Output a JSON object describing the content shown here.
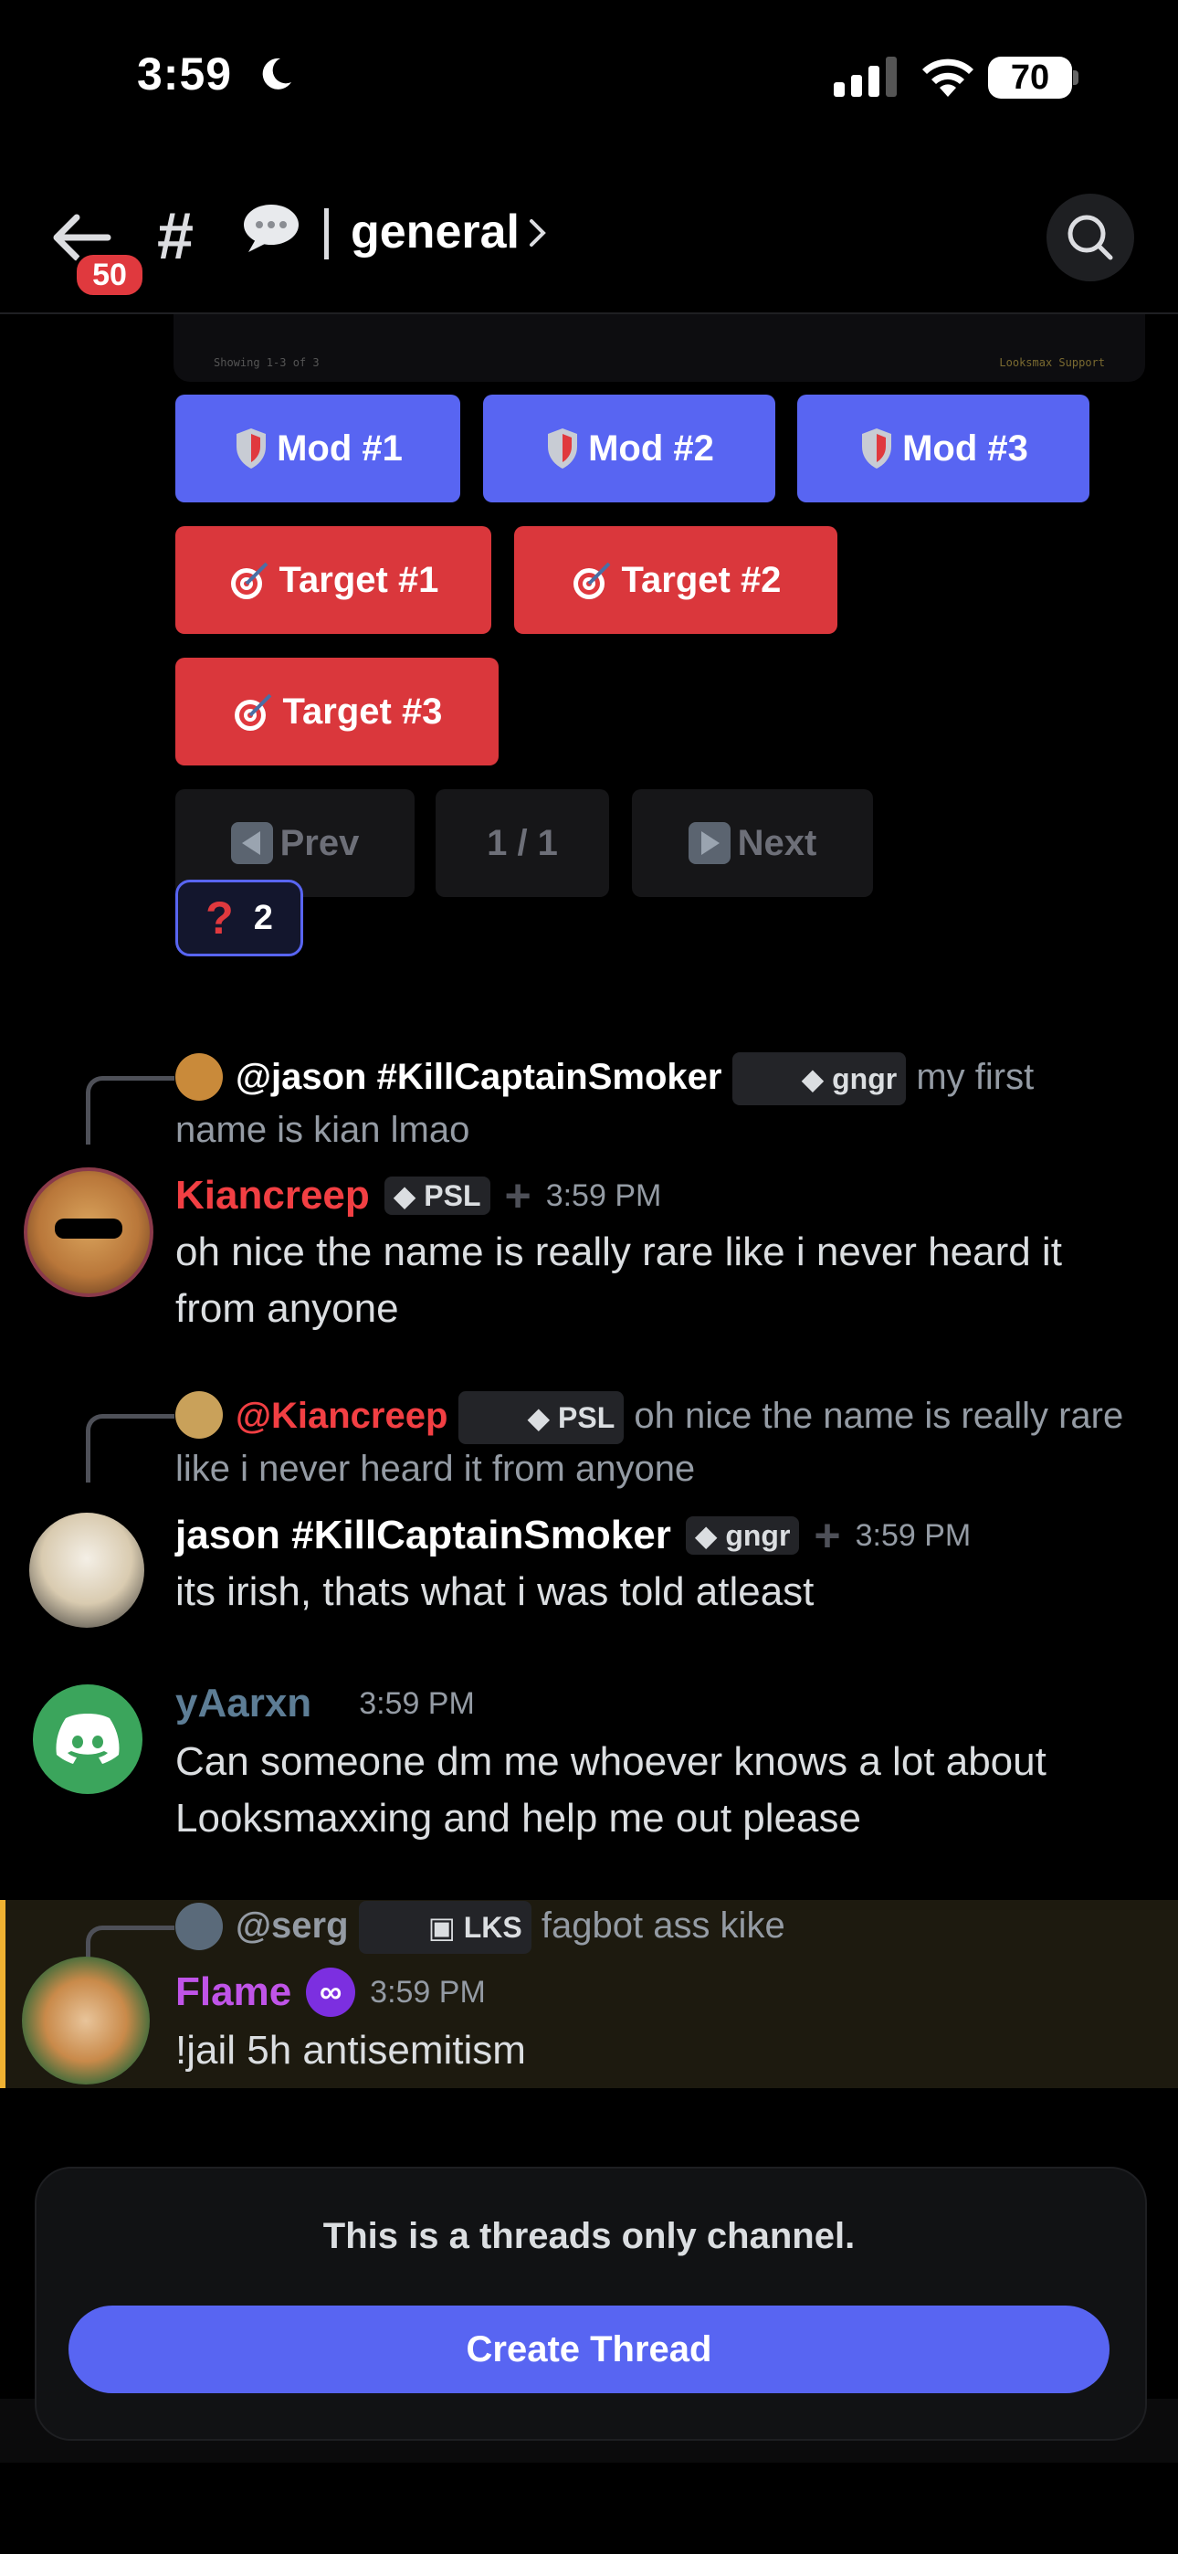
{
  "status_bar": {
    "time": "3:59",
    "battery": "70"
  },
  "header": {
    "back_badge": "50",
    "channel_name": "general"
  },
  "embed": {
    "left_text": "Showing 1-3 of 3",
    "right_text": "Looksmax Support"
  },
  "mod_buttons": [
    "Mod #1",
    "Mod #2",
    "Mod #3"
  ],
  "target_buttons": [
    "Target #1",
    "Target #2",
    "Target #3"
  ],
  "pager": {
    "prev": "Prev",
    "page": "1 / 1",
    "next": "Next"
  },
  "reaction": {
    "count": "2"
  },
  "messages": [
    {
      "reply": {
        "name": "@jason #KillCaptainSmoker",
        "tag": "gngr",
        "text": "my first name is kian lmao"
      },
      "author": "Kiancreep",
      "author_color": "#f23f43",
      "tag": "PSL",
      "time": "3:59 PM",
      "body": "oh nice the name is really rare like i never heard it from anyone"
    },
    {
      "reply": {
        "name": "@Kiancreep",
        "tag": "PSL",
        "text": "oh nice the name is really rare like i never heard it from anyone"
      },
      "author": "jason #KillCaptainSmoker",
      "author_color": "#ffffff",
      "tag": "gngr",
      "time": "3:59 PM",
      "body": "its irish, thats what i was told atleast"
    },
    {
      "author": "yAarxn",
      "author_color": "#5d7d95",
      "time": "3:59 PM",
      "body": "Can someone dm me whoever knows a lot about Looksmaxxing and help me out please"
    },
    {
      "reply": {
        "name": "@serg",
        "tag": "LKS",
        "text": "fagbot ass kike"
      },
      "author": "Flame",
      "author_color": "#c054e8",
      "time": "3:59 PM",
      "body": "!jail 5h antisemitism"
    }
  ],
  "composer": {
    "notice": "This is a threads only channel.",
    "button": "Create Thread"
  }
}
